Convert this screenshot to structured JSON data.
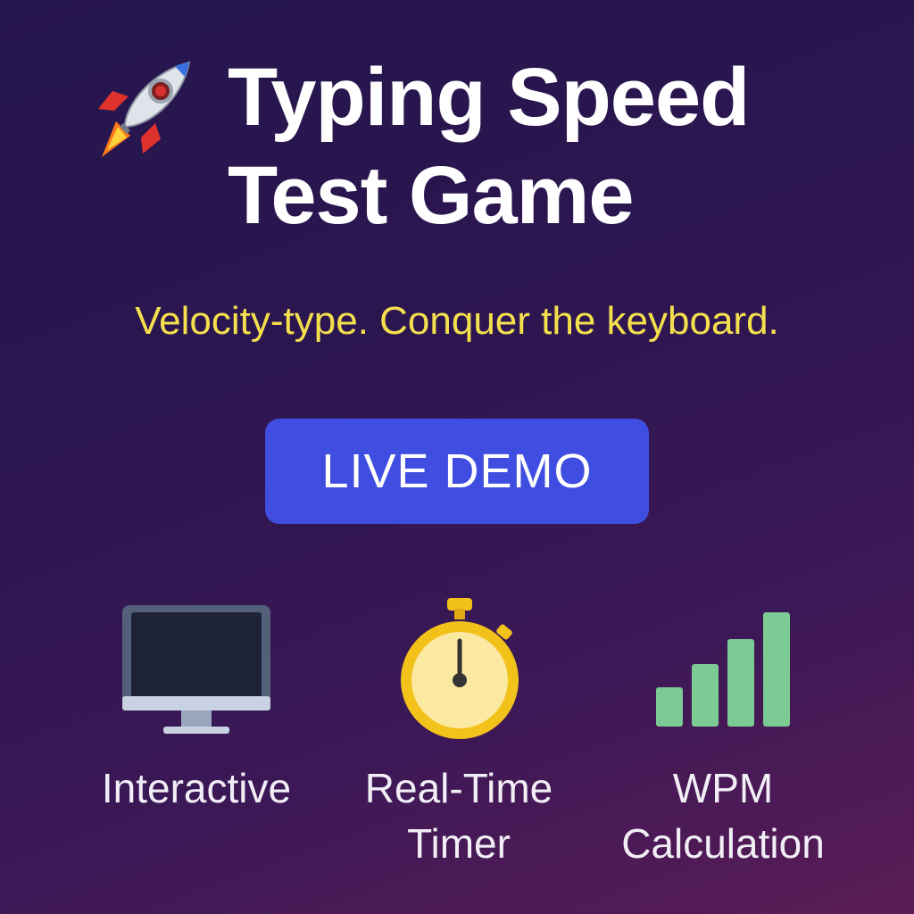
{
  "header": {
    "icon": "rocket-icon",
    "title": "Typing Speed\nTest Game",
    "tagline": "Velocity-type. Conquer the keyboard."
  },
  "cta": {
    "label": "LIVE DEMO",
    "color": "#3f4ee0"
  },
  "features": [
    {
      "icon": "monitor-icon",
      "label": "Interactive"
    },
    {
      "icon": "stopwatch-icon",
      "label": "Real-Time\nTimer"
    },
    {
      "icon": "bar-chart-icon",
      "label": "WPM\nCalculation"
    }
  ],
  "colors": {
    "background_top": "#25164d",
    "background_bottom": "#5a1c56",
    "tagline": "#f4e04d",
    "bars": "#7ccb94",
    "stopwatch": "#f2c21b"
  }
}
